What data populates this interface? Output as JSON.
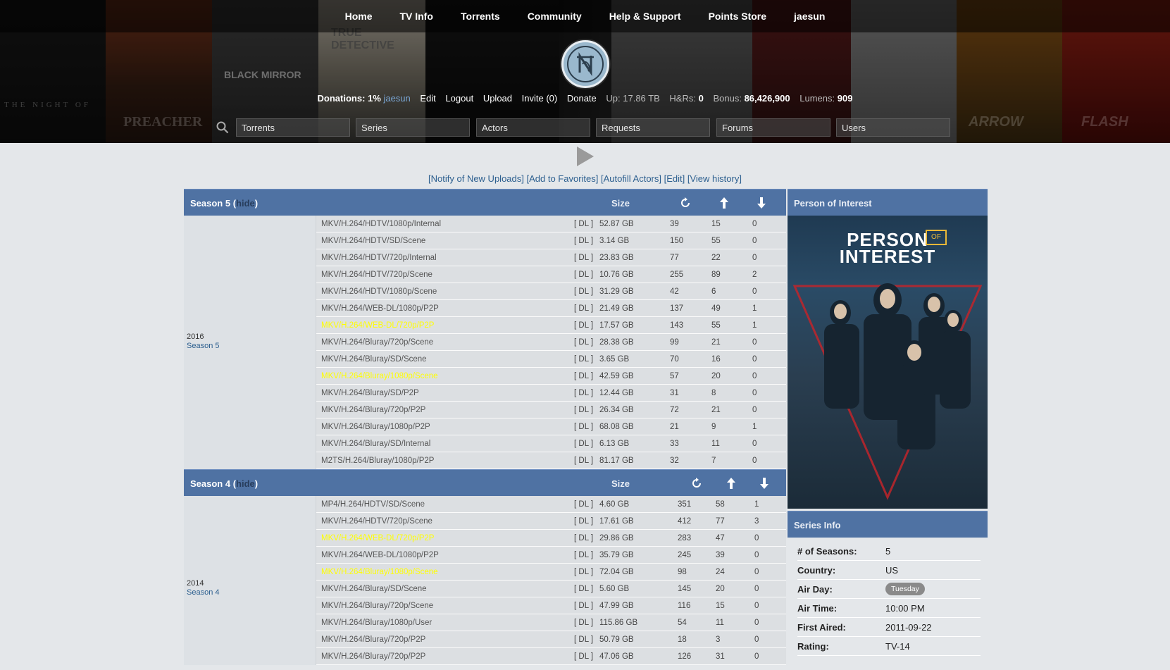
{
  "nav": [
    "Home",
    "TV Info",
    "Torrents",
    "Community",
    "Help & Support",
    "Points Store",
    "jaesun"
  ],
  "header_bg_text": [
    "THE NIGHT OF",
    "PREACHER",
    "BLACK MIRROR",
    "TRUE DETECTIVE",
    "ARROW",
    "FLASH"
  ],
  "userbar": {
    "donations_label": "Donations:",
    "donations_value": "1%",
    "username": "jaesun",
    "edit": "Edit",
    "logout": "Logout",
    "upload": "Upload",
    "invite": "Invite (0)",
    "donate": "Donate",
    "up_label": "Up:",
    "up_value": "17.86 TB",
    "hr_label": "H&Rs:",
    "hr_value": "0",
    "bonus_label": "Bonus:",
    "bonus_value": "86,426,900",
    "lumens_label": "Lumens:",
    "lumens_value": "909"
  },
  "search_fields": [
    "Torrents",
    "Series",
    "Actors",
    "Requests",
    "Forums",
    "Users"
  ],
  "actions": [
    "[Notify of New Uploads]",
    "[Add to Favorites]",
    "[Autofill Actors]",
    "[Edit]",
    "[View history]"
  ],
  "size_label": "Size",
  "hide_label": "hide",
  "dl_label": "[ DL ]",
  "seasons": [
    {
      "title": "Season 5",
      "year": "2016",
      "link": "Season 5",
      "rows": [
        {
          "name": "MKV/H.264/HDTV/1080p/Internal",
          "size": "52.87 GB",
          "seed": "39",
          "leech": "15",
          "snatch": "0",
          "hl": false
        },
        {
          "name": "MKV/H.264/HDTV/SD/Scene",
          "size": "3.14 GB",
          "seed": "150",
          "leech": "55",
          "snatch": "0",
          "hl": false
        },
        {
          "name": "MKV/H.264/HDTV/720p/Internal",
          "size": "23.83 GB",
          "seed": "77",
          "leech": "22",
          "snatch": "0",
          "hl": false
        },
        {
          "name": "MKV/H.264/HDTV/720p/Scene",
          "size": "10.76 GB",
          "seed": "255",
          "leech": "89",
          "snatch": "2",
          "hl": false
        },
        {
          "name": "MKV/H.264/HDTV/1080p/Scene",
          "size": "31.29 GB",
          "seed": "42",
          "leech": "6",
          "snatch": "0",
          "hl": false
        },
        {
          "name": "MKV/H.264/WEB-DL/1080p/P2P",
          "size": "21.49 GB",
          "seed": "137",
          "leech": "49",
          "snatch": "1",
          "hl": false
        },
        {
          "name": "MKV/H.264/WEB-DL/720p/P2P",
          "size": "17.57 GB",
          "seed": "143",
          "leech": "55",
          "snatch": "1",
          "hl": true
        },
        {
          "name": "MKV/H.264/Bluray/720p/Scene",
          "size": "28.38 GB",
          "seed": "99",
          "leech": "21",
          "snatch": "0",
          "hl": false
        },
        {
          "name": "MKV/H.264/Bluray/SD/Scene",
          "size": "3.65 GB",
          "seed": "70",
          "leech": "16",
          "snatch": "0",
          "hl": false
        },
        {
          "name": "MKV/H.264/Bluray/1080p/Scene",
          "size": "42.59 GB",
          "seed": "57",
          "leech": "20",
          "snatch": "0",
          "hl": true
        },
        {
          "name": "MKV/H.264/Bluray/SD/P2P",
          "size": "12.44 GB",
          "seed": "31",
          "leech": "8",
          "snatch": "0",
          "hl": false
        },
        {
          "name": "MKV/H.264/Bluray/720p/P2P",
          "size": "26.34 GB",
          "seed": "72",
          "leech": "21",
          "snatch": "0",
          "hl": false
        },
        {
          "name": "MKV/H.264/Bluray/1080p/P2P",
          "size": "68.08 GB",
          "seed": "21",
          "leech": "9",
          "snatch": "1",
          "hl": false
        },
        {
          "name": "MKV/H.264/Bluray/SD/Internal",
          "size": "6.13 GB",
          "seed": "33",
          "leech": "11",
          "snatch": "0",
          "hl": false
        },
        {
          "name": "M2TS/H.264/Bluray/1080p/P2P",
          "size": "81.17 GB",
          "seed": "32",
          "leech": "7",
          "snatch": "0",
          "hl": false
        }
      ]
    },
    {
      "title": "Season 4",
      "year": "2014",
      "link": "Season 4",
      "rows": [
        {
          "name": "MP4/H.264/HDTV/SD/Scene",
          "size": "4.60 GB",
          "seed": "351",
          "leech": "58",
          "snatch": "1",
          "hl": false
        },
        {
          "name": "MKV/H.264/HDTV/720p/Scene",
          "size": "17.61 GB",
          "seed": "412",
          "leech": "77",
          "snatch": "3",
          "hl": false
        },
        {
          "name": "MKV/H.264/WEB-DL/720p/P2P",
          "size": "29.86 GB",
          "seed": "283",
          "leech": "47",
          "snatch": "0",
          "hl": true
        },
        {
          "name": "MKV/H.264/WEB-DL/1080p/P2P",
          "size": "35.79 GB",
          "seed": "245",
          "leech": "39",
          "snatch": "0",
          "hl": false
        },
        {
          "name": "MKV/H.264/Bluray/1080p/Scene",
          "size": "72.04 GB",
          "seed": "98",
          "leech": "24",
          "snatch": "0",
          "hl": true
        },
        {
          "name": "MKV/H.264/Bluray/SD/Scene",
          "size": "5.60 GB",
          "seed": "145",
          "leech": "20",
          "snatch": "0",
          "hl": false
        },
        {
          "name": "MKV/H.264/Bluray/720p/Scene",
          "size": "47.99 GB",
          "seed": "116",
          "leech": "15",
          "snatch": "0",
          "hl": false
        },
        {
          "name": "MKV/H.264/Bluray/1080p/User",
          "size": "115.86 GB",
          "seed": "54",
          "leech": "11",
          "snatch": "0",
          "hl": false
        },
        {
          "name": "MKV/H.264/Bluray/720p/P2P",
          "size": "50.79 GB",
          "seed": "18",
          "leech": "3",
          "snatch": "0",
          "hl": false
        },
        {
          "name": "MKV/H.264/Bluray/720p/P2P",
          "size": "47.06 GB",
          "seed": "126",
          "leech": "31",
          "snatch": "0",
          "hl": false
        }
      ]
    }
  ],
  "sidebar": {
    "title": "Person of Interest",
    "poster_title_1": "PERSON",
    "poster_title_of": "OF",
    "poster_title_2": "INTEREST",
    "info_title": "Series Info",
    "info": [
      {
        "key": "# of Seasons:",
        "value": "5"
      },
      {
        "key": "Country:",
        "value": "US"
      },
      {
        "key": "Air Day:",
        "value": "Tuesday",
        "badge": true
      },
      {
        "key": "Air Time:",
        "value": "10:00 PM"
      },
      {
        "key": "First Aired:",
        "value": "2011-09-22"
      },
      {
        "key": "Rating:",
        "value": "TV-14"
      }
    ]
  },
  "colors": {
    "header_blue": "#4f72a3",
    "highlight_yellow": "#ffff00",
    "link_blue": "#2c5f8f"
  }
}
